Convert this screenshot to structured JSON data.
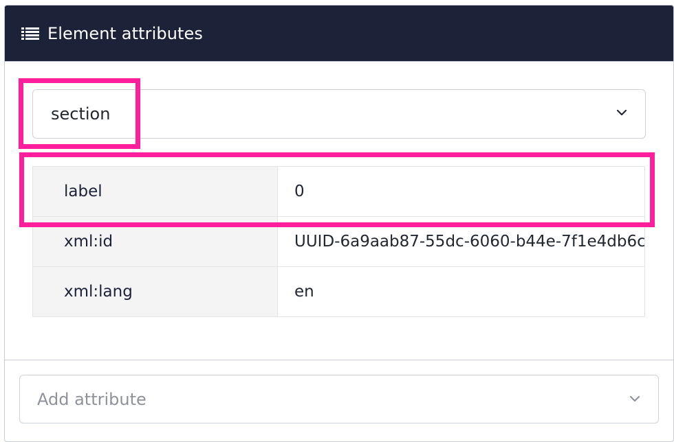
{
  "header": {
    "title": "Element attributes",
    "icon": "list-icon"
  },
  "element_select": {
    "value": "section",
    "icon": "chevron-down-icon"
  },
  "attributes": [
    {
      "name": "label",
      "value": "0"
    },
    {
      "name": "xml:id",
      "value": "UUID-6a9aab87-55dc-6060-b44e-7f1e4db6c"
    },
    {
      "name": "xml:lang",
      "value": "en"
    }
  ],
  "add_attribute": {
    "placeholder": "Add attribute",
    "icon": "chevron-down-icon"
  },
  "colors": {
    "header_bg": "#1c2238",
    "highlight": "#ff1f9d"
  }
}
